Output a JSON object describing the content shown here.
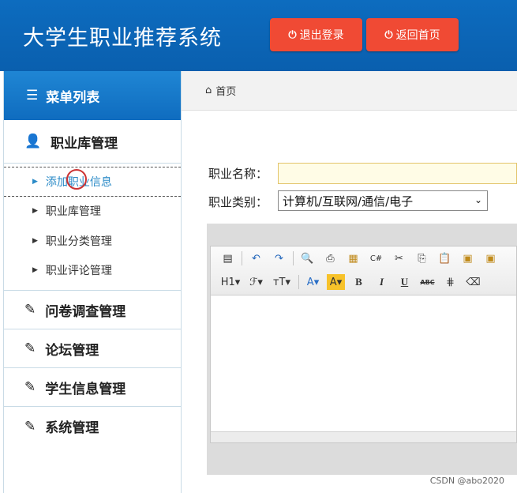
{
  "header": {
    "title": "大学生职业推荐系统",
    "logout_label": "退出登录",
    "home_label": "返回首页",
    "button_color": "#f04a34",
    "bg_color": "#0d6cbf"
  },
  "sidebar": {
    "heading": "菜单列表",
    "sections": [
      {
        "label": "职业库管理",
        "icon": "user-icon"
      },
      {
        "label": "问卷调查管理",
        "icon": "edit-icon"
      },
      {
        "label": "论坛管理",
        "icon": "edit-icon"
      },
      {
        "label": "学生信息管理",
        "icon": "edit-icon"
      },
      {
        "label": "系统管理",
        "icon": "edit-icon"
      }
    ],
    "sub_items": [
      "添加职业信息",
      "职业库管理",
      "职业分类管理",
      "职业评论管理"
    ]
  },
  "breadcrumb": {
    "label": "首页"
  },
  "form": {
    "name_label": "职业名称：",
    "name_value": "",
    "category_label": "职业类别：",
    "category_value": "计算机/互联网/通信/电子"
  },
  "editor": {
    "row2": {
      "h1": "H1",
      "text_color": "A",
      "bg_color": "A",
      "bold": "B",
      "italic": "I",
      "underline": "U",
      "abc": "ABC"
    }
  },
  "watermark": "CSDN @abo2020"
}
